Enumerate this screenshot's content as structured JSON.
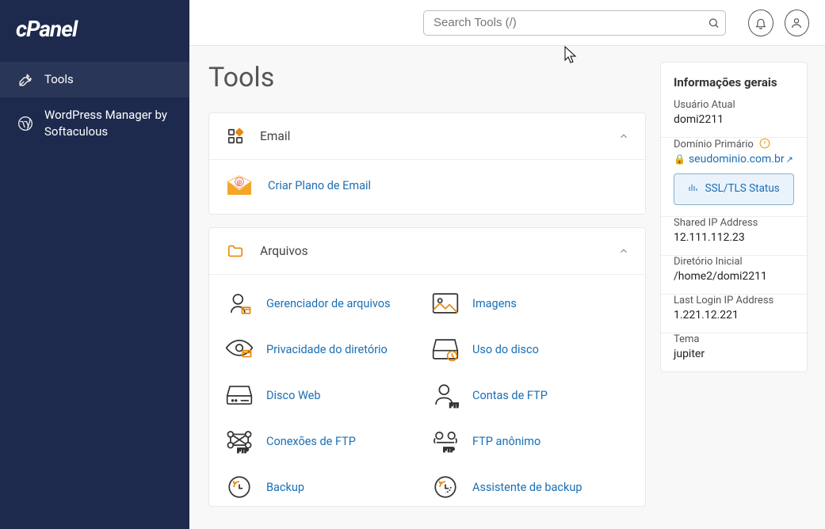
{
  "logo_alt": "cPanel",
  "sidebar": {
    "items": [
      {
        "label": "Tools"
      },
      {
        "label": "WordPress Manager by Softaculous"
      }
    ]
  },
  "search": {
    "placeholder": "Search Tools (/)"
  },
  "page": {
    "title": "Tools"
  },
  "email_panel": {
    "title": "Email",
    "item_label": "Criar Plano de Email"
  },
  "files_panel": {
    "title": "Arquivos",
    "items": [
      "Gerenciador de arquivos",
      "Imagens",
      "Privacidade do diretório",
      "Uso do disco",
      "Disco Web",
      "Contas de FTP",
      "Conexões de FTP",
      "FTP anônimo",
      "Backup",
      "Assistente de backup"
    ]
  },
  "info": {
    "title": "Informações gerais",
    "user_label": "Usuário Atual",
    "user_value": "domi2211",
    "domain_label": "Domínio Primário",
    "domain_value": "seudominio.com.br",
    "ssl_label": "SSL/TLS Status",
    "ip_label": "Shared IP Address",
    "ip_value": "12.111.112.23",
    "home_label": "Diretório Inicial",
    "home_value": "/home2/domi2211",
    "lastip_label": "Last Login IP Address",
    "lastip_value": "1.221.12.221",
    "theme_label": "Tema",
    "theme_value": "jupiter"
  }
}
